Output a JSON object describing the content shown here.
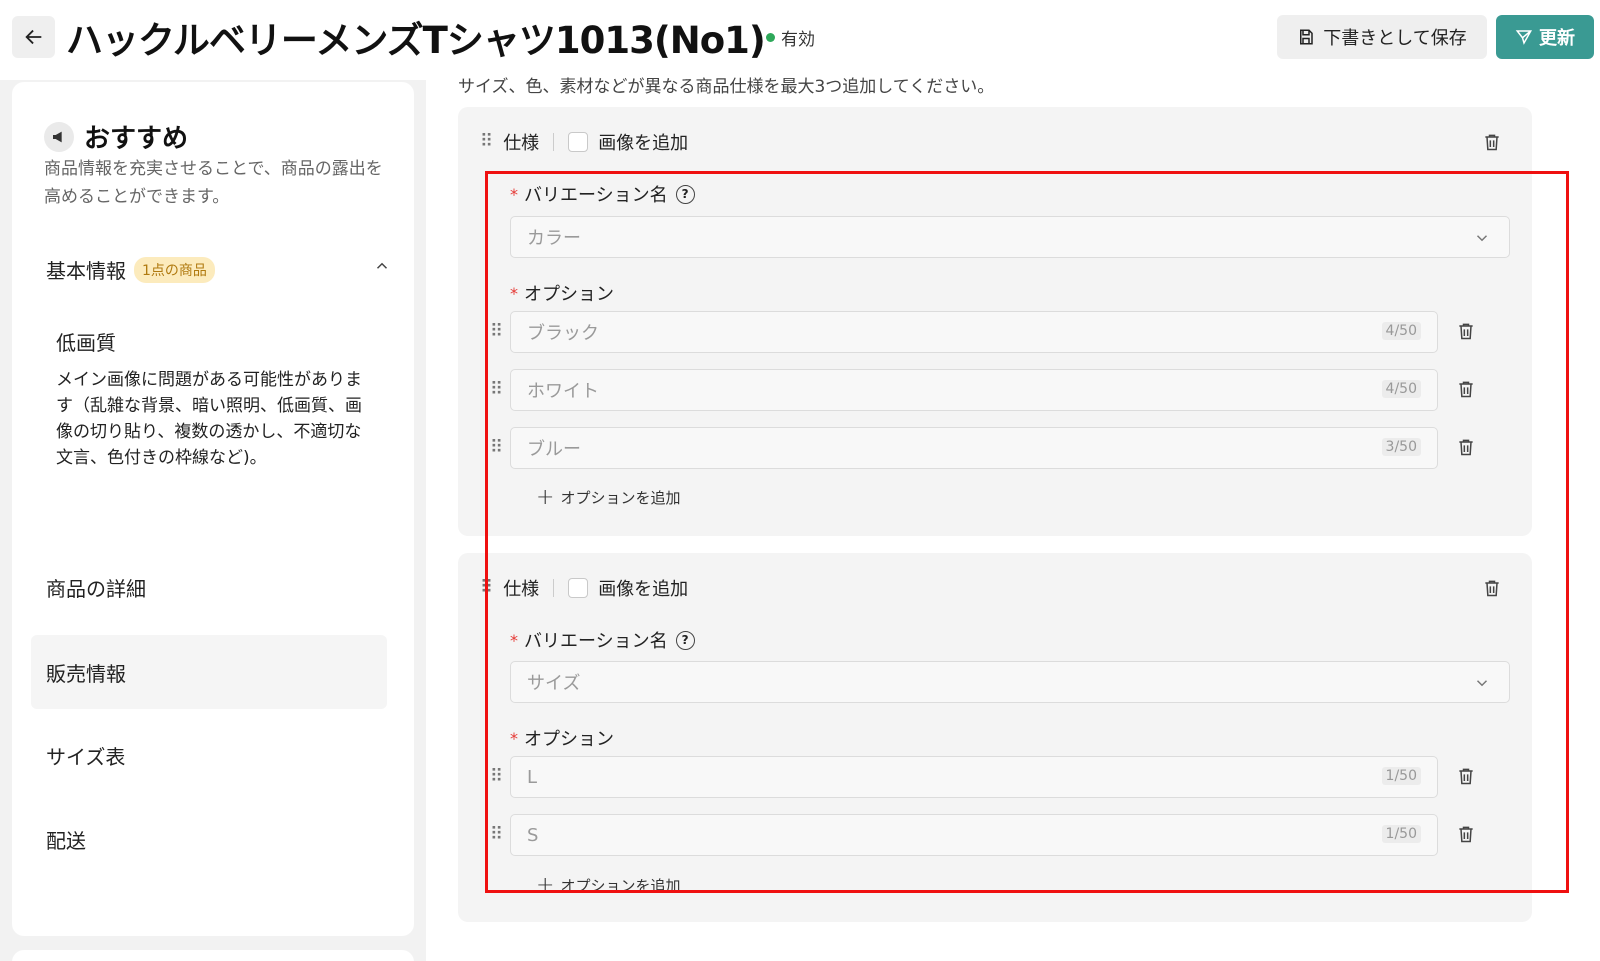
{
  "header": {
    "title": "ハックルベリーメンズTシャツ1013(No1)",
    "status": "有効",
    "draft_button": "下書きとして保存",
    "update_button": "更新"
  },
  "sidebar": {
    "recommend_title": "おすすめ",
    "recommend_text": "商品情報を充実させることで、商品の露出を高めることができます。",
    "basic_info": "基本情報",
    "basic_badge": "1点の商品",
    "issue_title": "低画質",
    "issue_text": "メイン画像に問題がある可能性があります（乱雑な背景、暗い照明、低画質、画像の切り貼り、複数の透かし、不適切な文言、色付きの枠線など)。",
    "nav": [
      "商品の詳細",
      "販売情報",
      "サイズ表",
      "配送"
    ],
    "active_nav": "販売情報"
  },
  "main": {
    "hint": "サイズ、色、素材などが異なる商品仕様を最大3つ追加してください。",
    "spec1": {
      "label": "仕様",
      "add_image": "画像を追加",
      "variation_label": "バリエーション名",
      "variation_value": "カラー",
      "options_label": "オプション",
      "options": [
        {
          "value": "ブラック",
          "count": "4/50"
        },
        {
          "value": "ホワイト",
          "count": "4/50"
        },
        {
          "value": "ブルー",
          "count": "3/50"
        }
      ],
      "add_option": "オプションを追加"
    },
    "spec2": {
      "label": "仕様",
      "add_image": "画像を追加",
      "variation_label": "バリエーション名",
      "variation_value": "サイズ",
      "options_label": "オプション",
      "options": [
        {
          "value": "L",
          "count": "1/50"
        },
        {
          "value": "S",
          "count": "1/50"
        }
      ],
      "add_option": "オプションを追加"
    }
  },
  "colors": {
    "accent": "#3a9a93",
    "status_active": "#2ea85a",
    "required": "#e53935",
    "highlight": "#ef1010"
  }
}
